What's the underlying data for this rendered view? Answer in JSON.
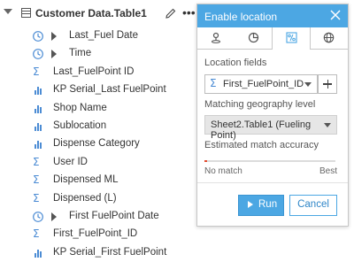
{
  "pane": {
    "title": "Customer Data.Table1",
    "fields": [
      {
        "label": "Last_Fuel Date",
        "icon": "clock-icon",
        "caret": true
      },
      {
        "label": "Time",
        "icon": "clock-icon",
        "caret": true
      },
      {
        "label": "Last_FuelPoint ID",
        "icon": "sigma-icon",
        "caret": false
      },
      {
        "label": "KP Serial_Last FuelPoint",
        "icon": "bar-chart-icon",
        "caret": false
      },
      {
        "label": "Shop Name",
        "icon": "bar-chart-icon",
        "caret": false
      },
      {
        "label": "Sublocation",
        "icon": "bar-chart-icon",
        "caret": false
      },
      {
        "label": "Dispense Category",
        "icon": "bar-chart-icon",
        "caret": false
      },
      {
        "label": "User ID",
        "icon": "sigma-icon",
        "caret": false
      },
      {
        "label": "Dispensed ML",
        "icon": "sigma-icon",
        "caret": false
      },
      {
        "label": "Dispensed (L)",
        "icon": "sigma-icon",
        "caret": false
      },
      {
        "label": "First FuelPoint Date",
        "icon": "clock-icon",
        "caret": true
      },
      {
        "label": "First_FuelPoint_ID",
        "icon": "sigma-icon",
        "caret": false
      },
      {
        "label": "KP Serial_First FuelPoint",
        "icon": "bar-chart-icon",
        "caret": false
      }
    ]
  },
  "dialog": {
    "title": "Enable location",
    "tabs": [
      "coordinates-tab-icon",
      "address-tab-icon",
      "location-fields-tab-icon",
      "geography-tab-icon"
    ],
    "location_fields_label": "Location fields",
    "location_field_value": "First_FuelPoint_ID",
    "geo_level_label": "Matching geography level",
    "geo_level_value": "Sheet2.Table1 (Fueling Point)",
    "accuracy_label": "Estimated match accuracy",
    "accuracy_min_label": "No match",
    "accuracy_max_label": "Best",
    "accuracy_fraction": 0.02,
    "run_label": "Run",
    "cancel_label": "Cancel"
  },
  "colors": {
    "accent": "#4ca7e3",
    "sigma": "#4c8cd4",
    "accuracy": "#e34b2e"
  }
}
